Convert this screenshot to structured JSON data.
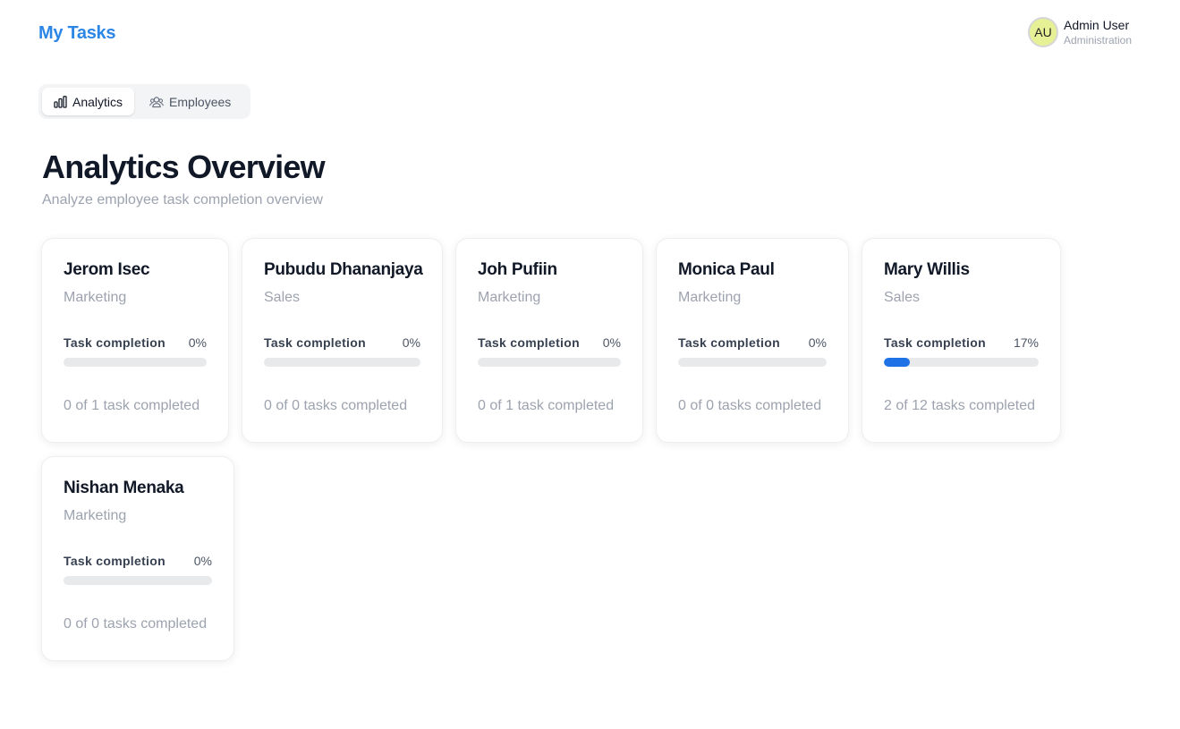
{
  "header": {
    "brand": "My Tasks",
    "user": {
      "initials": "AU",
      "name": "Admin User",
      "role": "Administration",
      "avatar_color": "#e6f196"
    }
  },
  "tabs": [
    {
      "label": "Analytics",
      "icon": "bar-chart-icon",
      "active": true
    },
    {
      "label": "Employees",
      "icon": "users-icon",
      "active": false
    }
  ],
  "main": {
    "title": "Analytics Overview",
    "subtitle": "Analyze employee task completion overview"
  },
  "accent_color": "#1f72e6",
  "employees": [
    {
      "name": "Jerom Isec",
      "department": "Marketing",
      "completion_label": "Task completion",
      "percent": "0%",
      "progress": 0,
      "summary": "0 of 1 task completed"
    },
    {
      "name": "Pubudu Dhananjaya",
      "department": "Sales",
      "completion_label": "Task completion",
      "percent": "0%",
      "progress": 0,
      "summary": "0 of 0 tasks completed"
    },
    {
      "name": "Joh Pufiin",
      "department": "Marketing",
      "completion_label": "Task completion",
      "percent": "0%",
      "progress": 0,
      "summary": "0 of 1 task completed"
    },
    {
      "name": "Monica Paul",
      "department": "Marketing",
      "completion_label": "Task completion",
      "percent": "0%",
      "progress": 0,
      "summary": "0 of 0 tasks completed"
    },
    {
      "name": "Mary Willis",
      "department": "Sales",
      "completion_label": "Task completion",
      "percent": "17%",
      "progress": 0.17,
      "summary": "2 of 12 tasks completed"
    },
    {
      "name": "Nishan Menaka",
      "department": "Marketing",
      "completion_label": "Task completion",
      "percent": "0%",
      "progress": 0,
      "summary": "0 of 0 tasks completed"
    }
  ]
}
